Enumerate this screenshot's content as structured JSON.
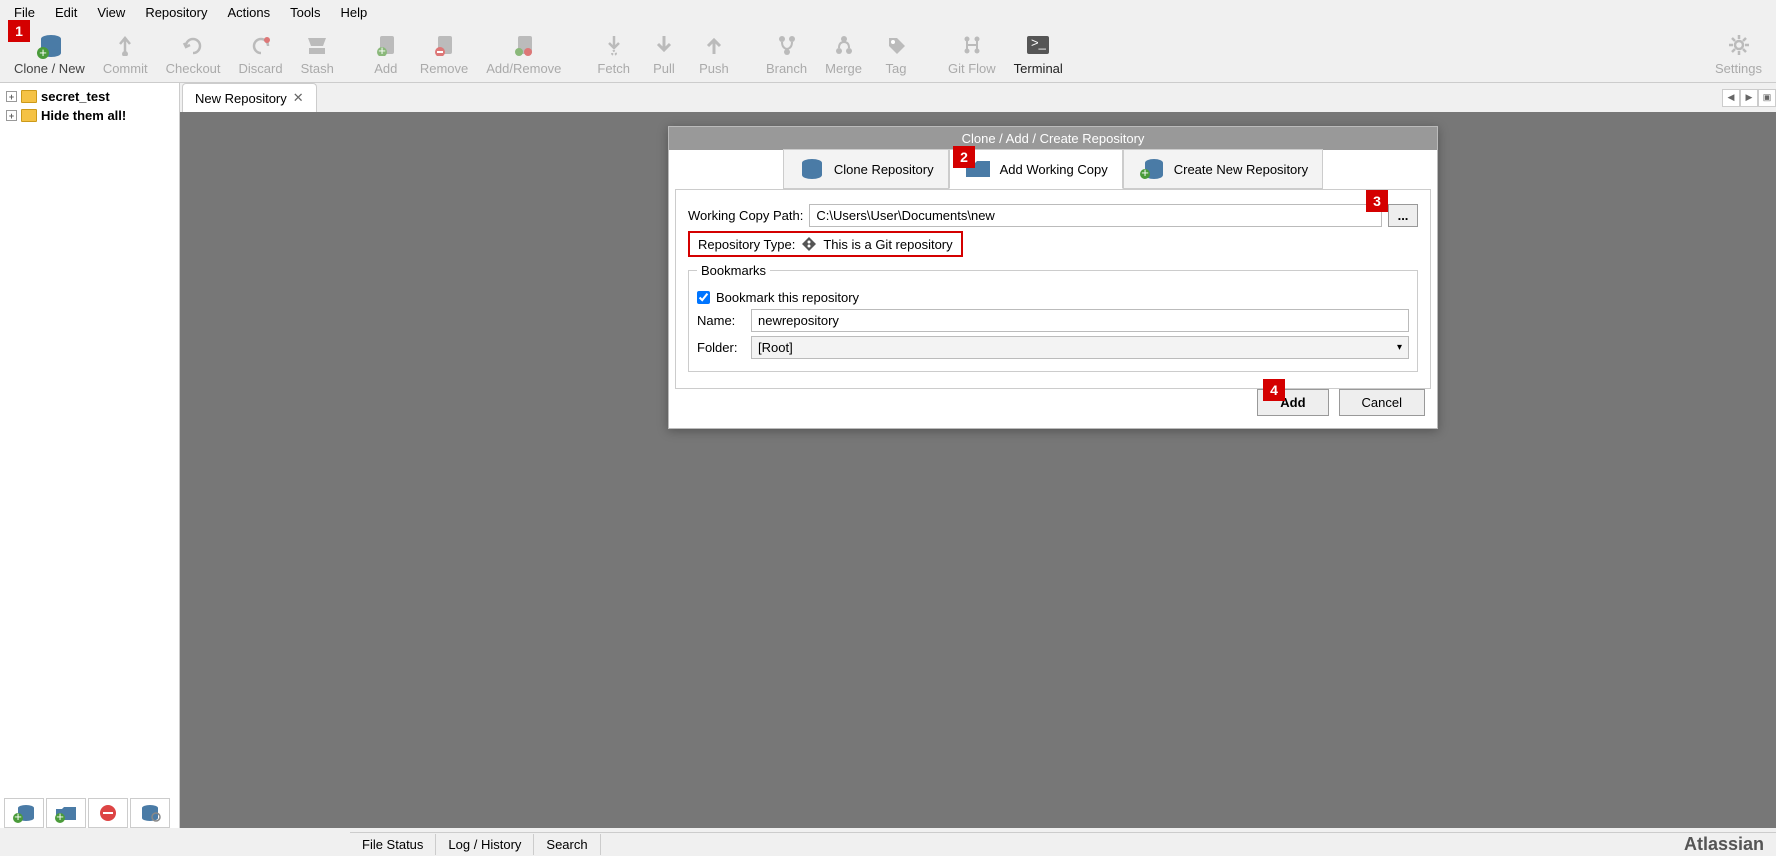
{
  "menu": [
    "File",
    "Edit",
    "View",
    "Repository",
    "Actions",
    "Tools",
    "Help"
  ],
  "toolbar": [
    {
      "label": "Clone / New",
      "disabled": false
    },
    {
      "label": "Commit",
      "disabled": true
    },
    {
      "label": "Checkout",
      "disabled": true
    },
    {
      "label": "Discard",
      "disabled": true
    },
    {
      "label": "Stash",
      "disabled": true
    },
    {
      "label": "Add",
      "disabled": true
    },
    {
      "label": "Remove",
      "disabled": true
    },
    {
      "label": "Add/Remove",
      "disabled": true
    },
    {
      "label": "Fetch",
      "disabled": true
    },
    {
      "label": "Pull",
      "disabled": true
    },
    {
      "label": "Push",
      "disabled": true
    },
    {
      "label": "Branch",
      "disabled": true
    },
    {
      "label": "Merge",
      "disabled": true
    },
    {
      "label": "Tag",
      "disabled": true
    },
    {
      "label": "Git Flow",
      "disabled": true
    },
    {
      "label": "Terminal",
      "disabled": false
    }
  ],
  "settings_label": "Settings",
  "sidebar": {
    "items": [
      "secret_test",
      "Hide them all!"
    ]
  },
  "tab": {
    "title": "New Repository"
  },
  "dialog": {
    "title": "Clone  / Add / Create Repository",
    "tabs": {
      "clone": "Clone Repository",
      "add": "Add Working Copy",
      "create": "Create New Repository"
    },
    "wcp_label": "Working Copy Path:",
    "wcp_value": "C:\\Users\\User\\Documents\\new",
    "browse": "...",
    "repo_type_label": "Repository Type:",
    "repo_type_value": "This is a Git repository",
    "bookmarks_legend": "Bookmarks",
    "bookmark_checkbox": "Bookmark this repository",
    "name_label": "Name:",
    "name_value": "newrepository",
    "folder_label": "Folder:",
    "folder_value": "[Root]",
    "add_btn": "Add",
    "cancel_btn": "Cancel"
  },
  "status": {
    "file_status": "File Status",
    "log": "Log / History",
    "search": "Search"
  },
  "brand": "Atlassian",
  "markers": {
    "1": "1",
    "2": "2",
    "3": "3",
    "4": "4"
  }
}
